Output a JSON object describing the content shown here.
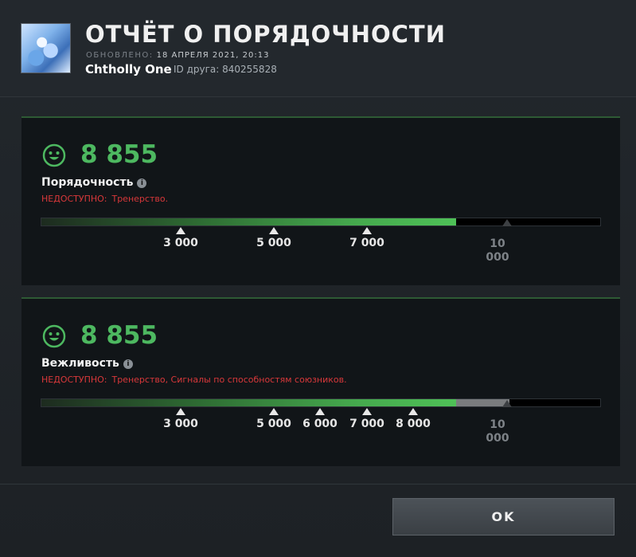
{
  "header": {
    "title": "ОТЧЁТ О ПОРЯДОЧНОСТИ",
    "updated_label": "ОБНОВЛЕНО:",
    "updated_date": "18 АПРЕЛЯ 2021, 20:13",
    "username": "Chtholly One",
    "friend_id": "ID друга: 840255828"
  },
  "panels": [
    {
      "score": "8 855",
      "name": "Порядочность",
      "unavailable_label": "НЕДОСТУПНО:",
      "unavailable_reason": "Тренерство.",
      "value": 8855,
      "max": 10000,
      "ticks": [
        "3 000",
        "5 000",
        "7 000"
      ],
      "max_label": "10 000",
      "accent": "#4db860",
      "icon": "smiley-icon"
    },
    {
      "score": "8 855",
      "name": "Вежливость",
      "unavailable_label": "НЕДОСТУПНО:",
      "unavailable_reason": "Тренерство, Сигналы по способностям союзников.",
      "value": 8855,
      "max": 10000,
      "ticks": [
        "3 000",
        "5 000",
        "6 000",
        "7 000",
        "8 000"
      ],
      "max_label": "10 000",
      "accent": "#4db860",
      "icon": "smiley-icon"
    }
  ],
  "footer": {
    "ok_label": "OK"
  }
}
